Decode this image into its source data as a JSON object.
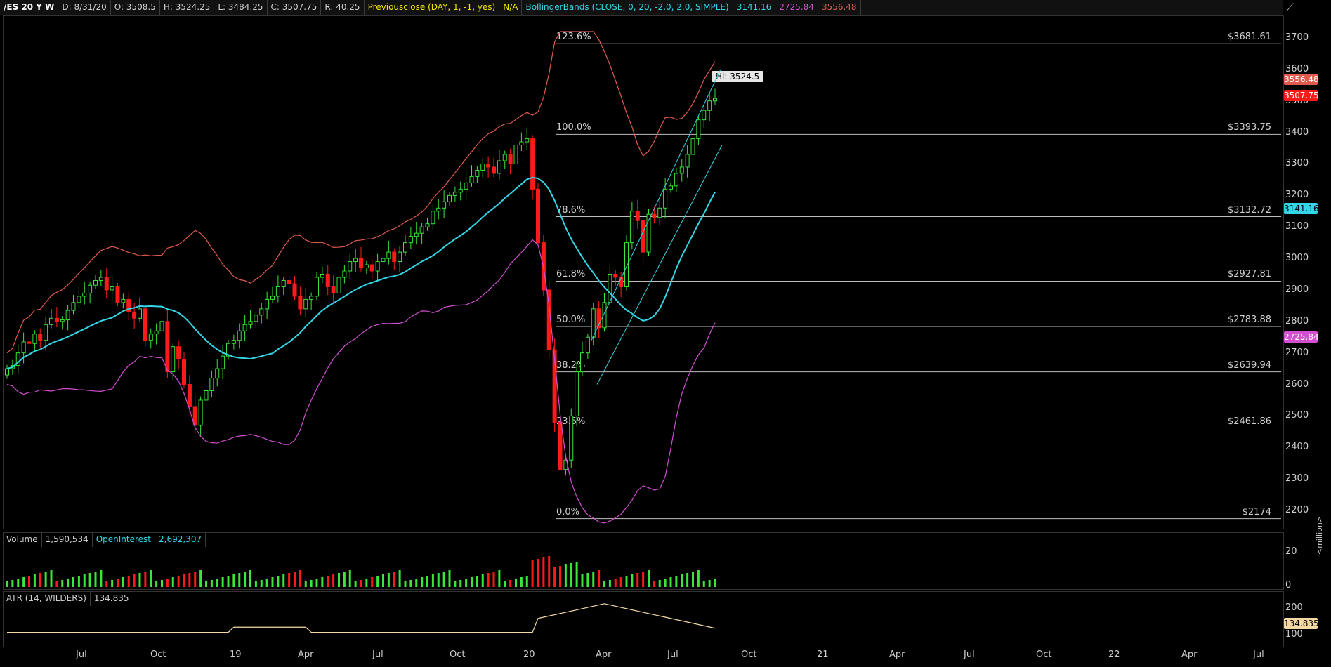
{
  "header": {
    "symbol": "/ES 20 Y W",
    "date": "D: 8/31/20",
    "open": "O: 3508.5",
    "high": "H: 3524.25",
    "low": "L: 3484.25",
    "close": "C: 3507.75",
    "range": "R: 40.25",
    "prev_close_label": "Previousclose (DAY, 1, -1, yes)",
    "prev_close_value": "N/A",
    "bb_label": "BollingerBands (CLOSE, 0, 20, -2.0, 2.0, SIMPLE)",
    "bb_mid": "3141.16",
    "bb_lower": "2725.84",
    "bb_upper": "3556.48"
  },
  "colors": {
    "up": "#39e639",
    "down": "#ff1a1a",
    "upper_band": "#e05a4e",
    "mid_band": "#33d6e6",
    "lower_band": "#d24fd0",
    "atr": "#f3d9a4",
    "channel": "#33d6e6"
  },
  "price_axis": {
    "ticks": [
      "3700",
      "3600",
      "3500",
      "3400",
      "3300",
      "3200",
      "3100",
      "3000",
      "2900",
      "2800",
      "2700",
      "2600",
      "2500",
      "2400",
      "2300",
      "2200"
    ]
  },
  "price_tags": {
    "upper": "3556.48",
    "last": "3507.75",
    "mid": "3141.16",
    "lower": "2725.84"
  },
  "hi_label": "Hi: 3524.5",
  "fib_levels": [
    {
      "pct": "123.6%",
      "price": "$3681.61",
      "value": 3681.61
    },
    {
      "pct": "100.0%",
      "price": "$3393.75",
      "value": 3393.75
    },
    {
      "pct": "78.6%",
      "price": "$3132.72",
      "value": 3132.72
    },
    {
      "pct": "61.8%",
      "price": "$2927.81",
      "value": 2927.81
    },
    {
      "pct": "50.0%",
      "price": "$2783.88",
      "value": 2783.88
    },
    {
      "pct": "38.2%",
      "price": "$2639.94",
      "value": 2639.94
    },
    {
      "pct": "23.6%",
      "price": "$2461.86",
      "value": 2461.86
    },
    {
      "pct": "0.0%",
      "price": "$2174",
      "value": 2174
    }
  ],
  "volume": {
    "label": "Volume",
    "value": "1,590,534",
    "oi_label": "OpenInterest",
    "oi_value": "2,692,307",
    "ticks": [
      "20",
      "0"
    ],
    "unit": "<million>"
  },
  "atr": {
    "label": "ATR (14, WILDERS)",
    "value": "134.835",
    "ticks": [
      "200",
      "100"
    ],
    "tag": "134.835"
  },
  "x_axis": {
    "ticks": [
      "Jul",
      "Oct",
      "19",
      "Apr",
      "Jul",
      "Oct",
      "20",
      "Apr",
      "Jul",
      "Oct",
      "21",
      "Apr",
      "Jul",
      "Oct",
      "22",
      "Apr",
      "Jul"
    ]
  },
  "chart_data": {
    "type": "candlestick",
    "title": "/ES 20 Y W",
    "ylim": [
      2120,
      3750
    ],
    "closes": [
      2650,
      2660,
      2700,
      2735,
      2730,
      2760,
      2740,
      2790,
      2810,
      2800,
      2805,
      2835,
      2860,
      2880,
      2890,
      2915,
      2930,
      2940,
      2900,
      2910,
      2860,
      2870,
      2830,
      2810,
      2840,
      2740,
      2760,
      2770,
      2800,
      2640,
      2720,
      2680,
      2600,
      2530,
      2470,
      2550,
      2580,
      2620,
      2650,
      2690,
      2730,
      2740,
      2770,
      2790,
      2800,
      2820,
      2840,
      2870,
      2880,
      2910,
      2930,
      2920,
      2880,
      2840,
      2870,
      2880,
      2940,
      2950,
      2910,
      2890,
      2940,
      2960,
      2990,
      3000,
      2970,
      2980,
      2960,
      2990,
      3000,
      3020,
      2990,
      3020,
      3050,
      3070,
      3080,
      3100,
      3110,
      3150,
      3160,
      3180,
      3200,
      3210,
      3220,
      3240,
      3260,
      3280,
      3300,
      3290,
      3270,
      3310,
      3330,
      3300,
      3360,
      3370,
      3380,
      3220,
      3050,
      2900,
      2710,
      2480,
      2330,
      2360,
      2500,
      2640,
      2700,
      2750,
      2840,
      2780,
      2860,
      2950,
      2940,
      2910,
      3050,
      3150,
      3120,
      3020,
      3140,
      3130,
      3160,
      3220,
      3230,
      3270,
      3290,
      3330,
      3380,
      3440,
      3470,
      3500,
      3508
    ]
  }
}
